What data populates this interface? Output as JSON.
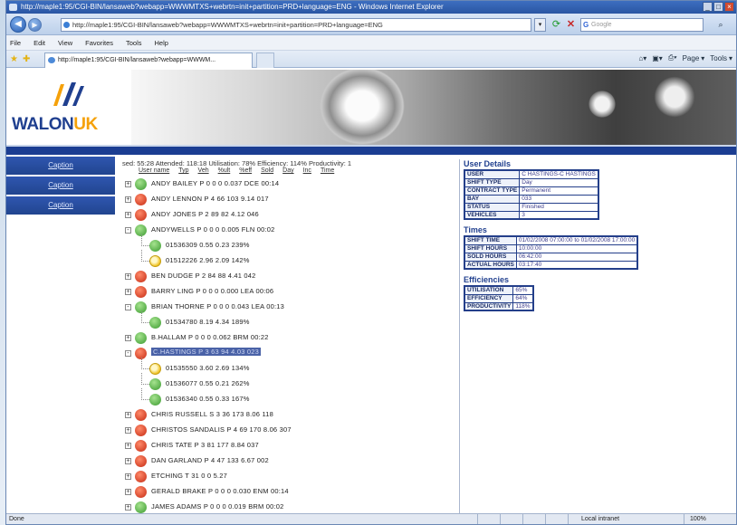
{
  "window": {
    "title": "http://maple1:95/CGI-BIN/lansaweb?webapp=WWWMTXS+webrtn=init+partition=PRD+language=ENG - Windows Internet Explorer"
  },
  "address_bar": {
    "url": "http://maple1:95/CGI-BIN/lansaweb?webapp=WWWMTXS+webrtn=init+partition=PRD+language=ENG",
    "search_placeholder": "Google"
  },
  "menu": [
    "File",
    "Edit",
    "View",
    "Favorites",
    "Tools",
    "Help"
  ],
  "tab": {
    "title": "http://maple1:95/CGI-BIN/lansaweb?webapp=WWWM..."
  },
  "command_bar": {
    "page": "Page",
    "tools": "Tools"
  },
  "logo": {
    "word1": "WALON",
    "word2": "UK"
  },
  "nav": [
    "Caption",
    "Caption",
    "Caption"
  ],
  "summary": "sed: 55:28 Attended: 118:18 Utilisation: 78% Efficiency: 114% Productivity: 1",
  "columns": [
    "User name",
    "Typ",
    "Veh",
    "%ult",
    "%eff",
    "Sold",
    "Day",
    "Inc",
    "Time"
  ],
  "rows": [
    {
      "text": "ANDY BAILEY     P  0  0  0  0.037 DCE 00:14",
      "status": "green",
      "child": false,
      "toggle": "+"
    },
    {
      "text": "ANDY LENNON     P  4  66  103  9.14 017",
      "status": "red",
      "child": false,
      "toggle": "+"
    },
    {
      "text": "ANDY JONES      P  2  89  82  4.12 046",
      "status": "red",
      "child": false,
      "toggle": "+"
    },
    {
      "text": "ANDYWELLS       P  0  0  0  0.005 FLN 00:02",
      "status": "green",
      "child": false,
      "toggle": "-"
    },
    {
      "text": "01536309        0.55  0.23  239%",
      "status": "green",
      "child": true,
      "toggle": ""
    },
    {
      "text": "01512226        2.96  2.09  142%",
      "status": "yellow",
      "child": true,
      "toggle": ""
    },
    {
      "text": "BEN DUDGE       P  2  84  88  4.41 042",
      "status": "red",
      "child": false,
      "toggle": "+"
    },
    {
      "text": "BARRY LING      P  0  0  0  0.000 LEA 00:06",
      "status": "red",
      "child": false,
      "toggle": "+"
    },
    {
      "text": "BRIAN THORNE    P  0  0  0  0.043 LEA 00:13",
      "status": "green",
      "child": false,
      "toggle": "-"
    },
    {
      "text": "01534780        8.19  4.34  189%",
      "status": "green",
      "child": true,
      "toggle": ""
    },
    {
      "text": "B.HALLAM        P  0  0  0  0.062 BRM 00:22",
      "status": "green",
      "child": false,
      "toggle": "+"
    },
    {
      "text": "C.HASTINGS      P  3  63  94  4.03 023",
      "status": "red",
      "child": false,
      "toggle": "-",
      "selected": true
    },
    {
      "text": "01535550        3.60  2.69  134%",
      "status": "yellow",
      "child": true,
      "toggle": ""
    },
    {
      "text": "01536077        0.55  0.21  262%",
      "status": "green",
      "child": true,
      "toggle": ""
    },
    {
      "text": "01536340        0.55  0.33  167%",
      "status": "green",
      "child": true,
      "toggle": ""
    },
    {
      "text": "CHRIS RUSSELL   S  3  36  173  8.06 118",
      "status": "red",
      "child": false,
      "toggle": "+"
    },
    {
      "text": "CHRISTOS SANDALIS  P  4  69  170  8.06 307",
      "status": "red",
      "child": false,
      "toggle": "+"
    },
    {
      "text": "CHRIS TATE      P  3  81  177  8.84 037",
      "status": "red",
      "child": false,
      "toggle": "+"
    },
    {
      "text": "DAN GARLAND     P  4  47  133  6.67 002",
      "status": "red",
      "child": false,
      "toggle": "+"
    },
    {
      "text": "ETCHING         T  31  0  0  5.27",
      "status": "red",
      "child": false,
      "toggle": "+"
    },
    {
      "text": "GERALD BRAKE    P  0  0  0  0.030 ENM 00:14",
      "status": "red",
      "child": false,
      "toggle": "+"
    },
    {
      "text": "JAMES ADAMS     P  0  0  0  0.019 BRM 00:02",
      "status": "green",
      "child": false,
      "toggle": "+"
    }
  ],
  "details": {
    "user_title": "User Details",
    "user": [
      [
        "USER",
        "C HASTINGS-C HASTINGS"
      ],
      [
        "SHIFT TYPE",
        "Day"
      ],
      [
        "CONTRACT TYPE",
        "Permanent"
      ],
      [
        "BAY",
        "033"
      ],
      [
        "STATUS",
        "Finished"
      ],
      [
        "VEHICLES",
        "3"
      ]
    ],
    "times_title": "Times",
    "times": [
      [
        "SHIFT TIME",
        "01/02/2008 07:00:00 to 01/02/2008 17:00:00"
      ],
      [
        "SHIFT HOURS",
        "10:00:00"
      ],
      [
        "SOLD HOURS",
        "06:42:00"
      ],
      [
        "ACTUAL HOURS",
        "03:17:40"
      ]
    ],
    "eff_title": "Efficiencies",
    "eff": [
      [
        "UTILISATION",
        "65%"
      ],
      [
        "EFFICIENCY",
        "64%"
      ],
      [
        "PRODUCTIVITY",
        "118%"
      ]
    ]
  },
  "status_bar": {
    "left": "Done",
    "zone": "Local intranet",
    "zoom": "100%"
  },
  "colors": {
    "brand_blue": "#1b3d92",
    "brand_orange": "#f5a10a",
    "nav_blue": "#2f56b0"
  }
}
